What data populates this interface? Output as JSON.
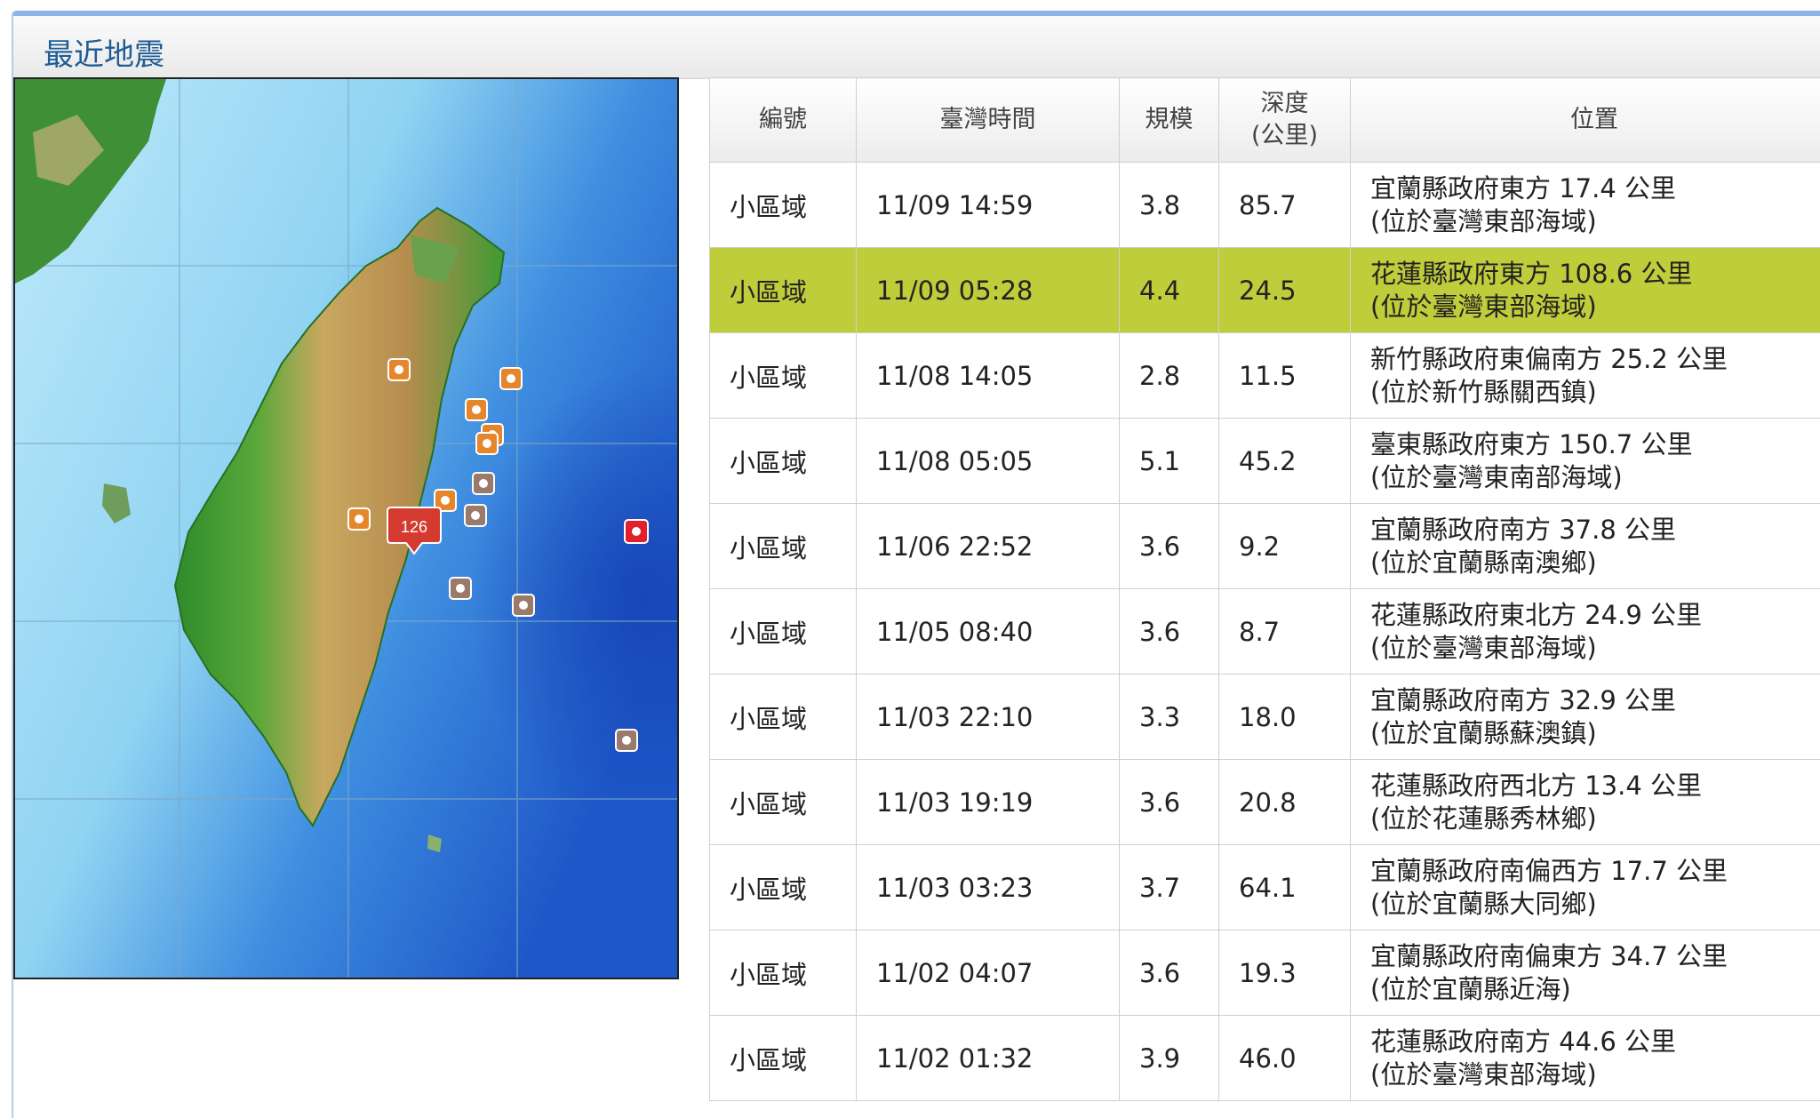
{
  "panel": {
    "title": "最近地震"
  },
  "map": {
    "badge_label": "126",
    "markers_count_note": "",
    "colors": {
      "sea_deep": "#1f5fd0",
      "sea_light": "#9edcf5",
      "land_low": "#2f8f2a",
      "land_high": "#c9a35a",
      "marker_recent": "#e6862a",
      "marker_old": "#9a7a6a",
      "marker_red": "#e0202a",
      "badge": "#d43a2f"
    }
  },
  "table": {
    "headers": {
      "id": "編號",
      "time": "臺灣時間",
      "magnitude": "規模",
      "depth_line1": "深度",
      "depth_line2": "(公里)",
      "location": "位置"
    },
    "rows": [
      {
        "type": "小區域",
        "time": "11/09 14:59",
        "magnitude": "3.8",
        "depth": "85.7",
        "loc_line1": "宜蘭縣政府東方 17.4 公里",
        "loc_line2": "(位於臺灣東部海域)"
      },
      {
        "type": "小區域",
        "time": "11/09 05:28",
        "magnitude": "4.4",
        "depth": "24.5",
        "loc_line1": "花蓮縣政府東方 108.6 公里",
        "loc_line2": "(位於臺灣東部海域)"
      },
      {
        "type": "小區域",
        "time": "11/08 14:05",
        "magnitude": "2.8",
        "depth": "11.5",
        "loc_line1": "新竹縣政府東偏南方 25.2 公里",
        "loc_line2": "(位於新竹縣關西鎮)"
      },
      {
        "type": "小區域",
        "time": "11/08 05:05",
        "magnitude": "5.1",
        "depth": "45.2",
        "loc_line1": "臺東縣政府東方 150.7 公里",
        "loc_line2": "(位於臺灣東南部海域)"
      },
      {
        "type": "小區域",
        "time": "11/06 22:52",
        "magnitude": "3.6",
        "depth": "9.2",
        "loc_line1": "宜蘭縣政府南方 37.8 公里",
        "loc_line2": "(位於宜蘭縣南澳鄉)"
      },
      {
        "type": "小區域",
        "time": "11/05 08:40",
        "magnitude": "3.6",
        "depth": "8.7",
        "loc_line1": "花蓮縣政府東北方 24.9 公里",
        "loc_line2": "(位於臺灣東部海域)"
      },
      {
        "type": "小區域",
        "time": "11/03 22:10",
        "magnitude": "3.3",
        "depth": "18.0",
        "loc_line1": "宜蘭縣政府南方 32.9 公里",
        "loc_line2": "(位於宜蘭縣蘇澳鎮)"
      },
      {
        "type": "小區域",
        "time": "11/03 19:19",
        "magnitude": "3.6",
        "depth": "20.8",
        "loc_line1": "花蓮縣政府西北方 13.4 公里",
        "loc_line2": "(位於花蓮縣秀林鄉)"
      },
      {
        "type": "小區域",
        "time": "11/03 03:23",
        "magnitude": "3.7",
        "depth": "64.1",
        "loc_line1": "宜蘭縣政府南偏西方 17.7 公里",
        "loc_line2": "(位於宜蘭縣大同鄉)"
      },
      {
        "type": "小區域",
        "time": "11/02 04:07",
        "magnitude": "3.6",
        "depth": "19.3",
        "loc_line1": "宜蘭縣政府南偏東方 34.7 公里",
        "loc_line2": "(位於宜蘭縣近海)"
      },
      {
        "type": "小區域",
        "time": "11/02 01:32",
        "magnitude": "3.9",
        "depth": "46.0",
        "loc_line1": "花蓮縣政府南方 44.6 公里",
        "loc_line2": "(位於臺灣東部海域)"
      }
    ],
    "highlighted_row": 1,
    "highlight_color": "#bfcd3b"
  }
}
